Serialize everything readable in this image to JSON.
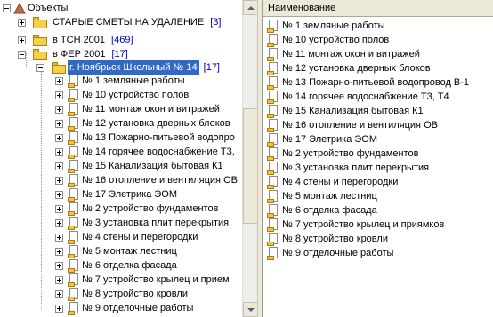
{
  "tree": {
    "root": {
      "label": "Объекты"
    },
    "groups": [
      {
        "label": "СТАРЫЕ СМЕТЫ НА УДАЛЕНИЕ",
        "count": "[3]"
      },
      {
        "label": "в ТСН 2001",
        "count": "[469]"
      },
      {
        "label": "в ФЕР 2001",
        "count": "[17]"
      }
    ],
    "selected_object": {
      "label": "г. Ноябрьск Школьный № 14",
      "count": "[17]"
    },
    "items": [
      "№ 1 земляные работы",
      "№ 10 устройство полов",
      "№ 11 монтаж окон и витражей",
      "№ 12 установка дверных блоков",
      "№ 13 Пожарно-питьевой водопро",
      "№ 14 горячее водоснабжение Т3,",
      "№ 15 Канализация бытовая К1",
      "№ 16 отопление и вентиляция ОВ",
      "№ 17 Элетрика ЭОМ",
      "№ 2 устройство фундаментов",
      "№ 3 установка плит перекрытия",
      "№ 4 стены и перегородки",
      "№ 5 монтаж лестниц",
      "№ 6 отделка фасада",
      "№ 7 устройство крылец и прием",
      "№ 8 устройство кровли",
      "№ 9 отделочные работы"
    ]
  },
  "list": {
    "header": "Наименование",
    "items": [
      "№ 1 земляные работы",
      "№ 10 устройство полов",
      "№ 11 монтаж окон и витражей",
      "№ 12 установка дверных блоков",
      "№ 13 Пожарно-питьевой водопровод В-1",
      "№ 14 горячее водоснабжение Т3, Т4",
      "№ 15 Канализация бытовая К1",
      "№ 16 отопление и вентиляция ОВ",
      "№ 17 Элетрика ЭОМ",
      "№ 2 устройство фундаментов",
      "№ 3 установка плит перекрытия",
      "№ 4 стены и перегородки",
      "№ 5 монтаж лестниц",
      "№ 6 отделка фасада",
      "№ 7 устройство крылец и приямков",
      "№ 8 устройство кровли",
      "№ 9 отделочные работы"
    ]
  },
  "colors": {
    "selection": "#316ac5",
    "count_text": "#0000c0",
    "folder": "#f7d04a"
  }
}
